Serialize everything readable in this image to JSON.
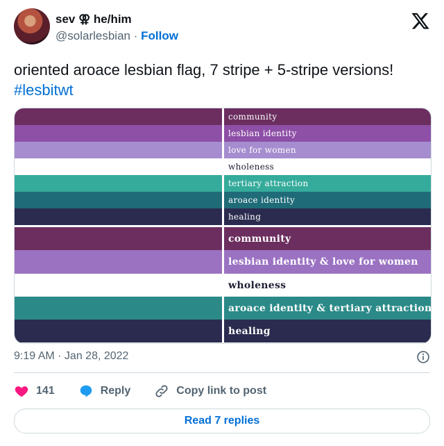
{
  "author": {
    "display_name": "sev ⚢ he/him",
    "handle": "@solarlesbian",
    "separator": "·",
    "follow_label": "Follow"
  },
  "tweet": {
    "text": "oriented aroace lesbian flag, 7 stripe + 5-stripe versions!",
    "hashtag": "#lesbitwt"
  },
  "flag_7": [
    {
      "label": "community",
      "color": "#6b2e5f",
      "text_color": "#ffffff"
    },
    {
      "label": "lesbian identity",
      "color": "#8e4fa6",
      "text_color": "#ffffff"
    },
    {
      "label": "love for women",
      "color": "#a58dcf",
      "text_color": "#ffffff"
    },
    {
      "label": "wholeness",
      "color": "#ffffff",
      "text_color": "#1e1e33"
    },
    {
      "label": "tertiary attraction",
      "color": "#35ab9b",
      "text_color": "#ffffff"
    },
    {
      "label": "aroace identity",
      "color": "#1f6b78",
      "text_color": "#ffffff"
    },
    {
      "label": "healing",
      "color": "#2b2b4f",
      "text_color": "#ffffff"
    }
  ],
  "flag_5": [
    {
      "label": "community",
      "color": "#6b2e5f",
      "text_color": "#ffffff"
    },
    {
      "label": "lesbian identity & love for women",
      "color": "#9b72c2",
      "text_color": "#ffffff"
    },
    {
      "label": "wholeness",
      "color": "#ffffff",
      "text_color": "#1e1e33"
    },
    {
      "label": "aroace identity & tertiary attraction",
      "color": "#2b8a88",
      "text_color": "#ffffff"
    },
    {
      "label": "healing",
      "color": "#2b2b4f",
      "text_color": "#ffffff"
    }
  ],
  "timestamp": "9:19 AM · Jan 28, 2022",
  "actions": {
    "likes": "141",
    "reply_label": "Reply",
    "copy_label": "Copy link to post"
  },
  "read_replies_label": "Read 7 replies",
  "colors": {
    "link": "#006fd6",
    "like": "#f91880",
    "reply_icon": "#1d9bf0"
  }
}
